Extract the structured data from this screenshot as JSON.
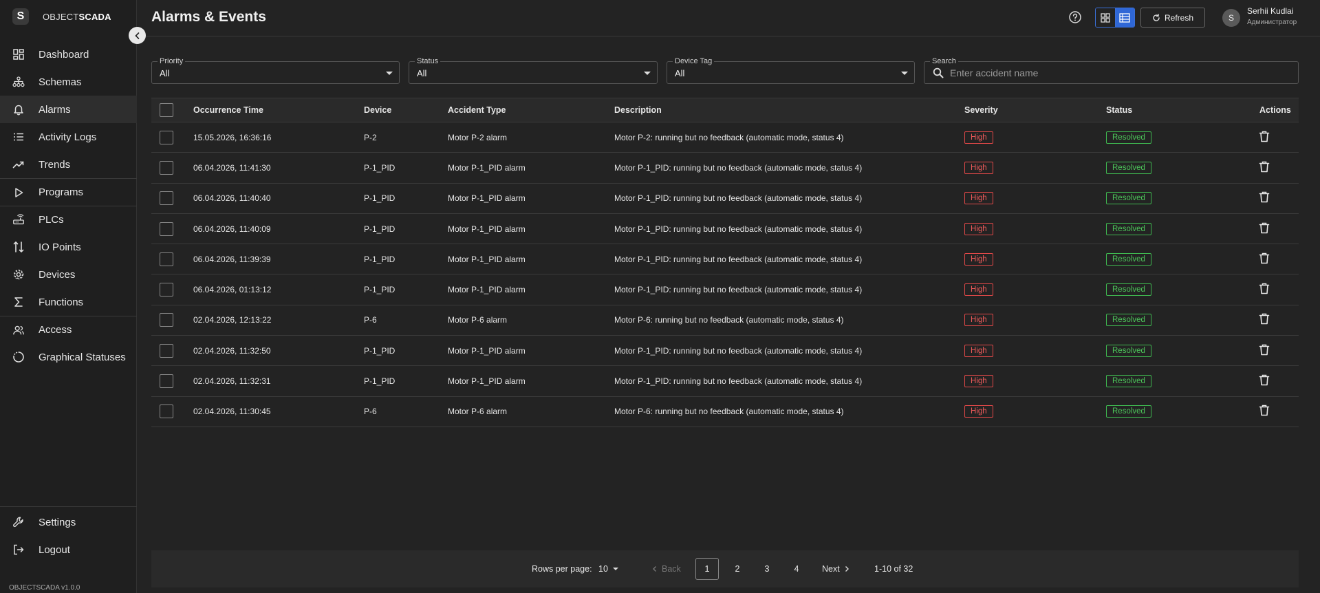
{
  "app": {
    "logo_letter": "S",
    "logo_prefix": "OBJECT",
    "logo_suffix": "SCADA",
    "version": "OBJECTSCADA v1.0.0"
  },
  "sidebar": {
    "items": [
      {
        "label": "Dashboard",
        "icon": "dashboard-icon"
      },
      {
        "label": "Schemas",
        "icon": "schema-icon"
      },
      {
        "label": "Alarms",
        "icon": "bell-icon"
      },
      {
        "label": "Activity Logs",
        "icon": "list-icon"
      },
      {
        "label": "Trends",
        "icon": "trend-icon"
      },
      {
        "label": "Programs",
        "icon": "play-icon"
      },
      {
        "label": "PLCs",
        "icon": "router-icon"
      },
      {
        "label": "IO Points",
        "icon": "io-icon"
      },
      {
        "label": "Devices",
        "icon": "gear-icon"
      },
      {
        "label": "Functions",
        "icon": "sigma-icon"
      },
      {
        "label": "Access",
        "icon": "users-icon"
      },
      {
        "label": "Graphical Statuses",
        "icon": "circle-icon"
      }
    ],
    "active": "Alarms",
    "bottom": [
      {
        "label": "Settings",
        "icon": "wrench-icon"
      },
      {
        "label": "Logout",
        "icon": "logout-icon"
      }
    ]
  },
  "header": {
    "title": "Alarms & Events",
    "refresh_label": "Refresh",
    "user_initial": "S",
    "user_name": "Serhii Kudlai",
    "user_role": "Администратор"
  },
  "filters": {
    "priority": {
      "label": "Priority",
      "value": "All"
    },
    "status": {
      "label": "Status",
      "value": "All"
    },
    "device_tag": {
      "label": "Device Tag",
      "value": "All"
    },
    "search": {
      "label": "Search",
      "placeholder": "Enter accident name"
    }
  },
  "table": {
    "columns": [
      "Occurrence Time",
      "Device",
      "Accident Type",
      "Description",
      "Severity",
      "Status",
      "Actions"
    ],
    "rows": [
      {
        "time": "15.05.2026, 16:36:16",
        "device": "P-2",
        "type": "Motor P-2 alarm",
        "description": "Motor P-2: running but no feedback (automatic mode, status 4)",
        "severity": "High",
        "status": "Resolved"
      },
      {
        "time": "06.04.2026, 11:41:30",
        "device": "P-1_PID",
        "type": "Motor P-1_PID alarm",
        "description": "Motor P-1_PID: running but no feedback (automatic mode, status 4)",
        "severity": "High",
        "status": "Resolved"
      },
      {
        "time": "06.04.2026, 11:40:40",
        "device": "P-1_PID",
        "type": "Motor P-1_PID alarm",
        "description": "Motor P-1_PID: running but no feedback (automatic mode, status 4)",
        "severity": "High",
        "status": "Resolved"
      },
      {
        "time": "06.04.2026, 11:40:09",
        "device": "P-1_PID",
        "type": "Motor P-1_PID alarm",
        "description": "Motor P-1_PID: running but no feedback (automatic mode, status 4)",
        "severity": "High",
        "status": "Resolved"
      },
      {
        "time": "06.04.2026, 11:39:39",
        "device": "P-1_PID",
        "type": "Motor P-1_PID alarm",
        "description": "Motor P-1_PID: running but no feedback (automatic mode, status 4)",
        "severity": "High",
        "status": "Resolved"
      },
      {
        "time": "06.04.2026, 01:13:12",
        "device": "P-1_PID",
        "type": "Motor P-1_PID alarm",
        "description": "Motor P-1_PID: running but no feedback (automatic mode, status 4)",
        "severity": "High",
        "status": "Resolved"
      },
      {
        "time": "02.04.2026, 12:13:22",
        "device": "P-6",
        "type": "Motor P-6 alarm",
        "description": "Motor P-6: running but no feedback (automatic mode, status 4)",
        "severity": "High",
        "status": "Resolved"
      },
      {
        "time": "02.04.2026, 11:32:50",
        "device": "P-1_PID",
        "type": "Motor P-1_PID alarm",
        "description": "Motor P-1_PID: running but no feedback (automatic mode, status 4)",
        "severity": "High",
        "status": "Resolved"
      },
      {
        "time": "02.04.2026, 11:32:31",
        "device": "P-1_PID",
        "type": "Motor P-1_PID alarm",
        "description": "Motor P-1_PID: running but no feedback (automatic mode, status 4)",
        "severity": "High",
        "status": "Resolved"
      },
      {
        "time": "02.04.2026, 11:30:45",
        "device": "P-6",
        "type": "Motor P-6 alarm",
        "description": "Motor P-6: running but no feedback (automatic mode, status 4)",
        "severity": "High",
        "status": "Resolved"
      }
    ]
  },
  "pagination": {
    "rows_per_page_label": "Rows per page:",
    "rows_per_page": "10",
    "back_label": "Back",
    "pages": [
      "1",
      "2",
      "3",
      "4"
    ],
    "current_page": "1",
    "next_label": "Next",
    "range": "1-10 of 32"
  },
  "colors": {
    "accent": "#2f67d6",
    "severity_high": "#e04848",
    "status_resolved": "#3fb950"
  }
}
